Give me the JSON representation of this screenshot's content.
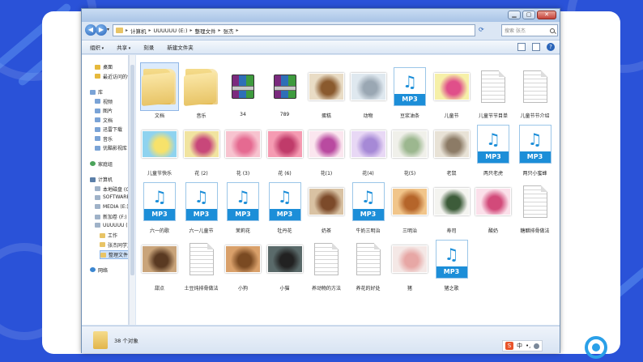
{
  "window": {
    "controls": {
      "minimize": "▁",
      "maximize": "▢",
      "close": "✕"
    }
  },
  "address": {
    "back": "◀",
    "forward": "▶",
    "dropdown": "▾",
    "crumbs": [
      "计算机",
      "UUUUUU (E:)",
      "整理文件",
      "张杰"
    ],
    "separator": "▸",
    "refresh": "⟳",
    "search_placeholder": "搜索 张杰"
  },
  "toolbar": {
    "organize": "组织",
    "share": "共享",
    "burn": "刻录",
    "new_folder": "新建文件夹",
    "help": "?"
  },
  "nav": {
    "favorites": [
      {
        "label": "桌面",
        "icon": "desktop-icon"
      },
      {
        "label": "最近访问的位置",
        "icon": "recent-icon"
      }
    ],
    "libraries_header": "库",
    "libraries": [
      {
        "label": "视频",
        "icon": "video-icon"
      },
      {
        "label": "图片",
        "icon": "picture-icon"
      },
      {
        "label": "文档",
        "icon": "document-icon"
      },
      {
        "label": "迅雷下载",
        "icon": "download-icon"
      },
      {
        "label": "音乐",
        "icon": "music-icon"
      },
      {
        "label": "优酷影视库",
        "icon": "youku-icon"
      }
    ],
    "homegroup": "家庭组",
    "computer_header": "计算机",
    "drives": [
      {
        "label": "本地磁盘 (C:)"
      },
      {
        "label": "SOFTWARE (D:)"
      },
      {
        "label": "MEDIA (E:)"
      },
      {
        "label": "新加卷 (F:)"
      },
      {
        "label": "UUUUUU (E:)"
      }
    ],
    "folders": [
      {
        "label": "工作"
      },
      {
        "label": "张杰同学文件"
      },
      {
        "label": "整理文件",
        "selected": true
      }
    ],
    "network": "网络"
  },
  "files": [
    {
      "name": "文档",
      "type": "folder",
      "selected": true
    },
    {
      "name": "音乐",
      "type": "folder"
    },
    {
      "name": "34",
      "type": "rar"
    },
    {
      "name": "789",
      "type": "rar"
    },
    {
      "name": "蛋糕",
      "type": "image",
      "colors": [
        "#e9dcc5",
        "#8a5a2e"
      ]
    },
    {
      "name": "动物",
      "type": "image",
      "colors": [
        "#dfe8ef",
        "#9aa7b3"
      ]
    },
    {
      "name": "豆浆油条",
      "type": "mp3"
    },
    {
      "name": "儿童节",
      "type": "image",
      "colors": [
        "#f6f0a8",
        "#e04f8a"
      ]
    },
    {
      "name": "儿童节节目单",
      "type": "doc"
    },
    {
      "name": "儿童节节介绍",
      "type": "doc"
    },
    {
      "name": "儿童节快乐",
      "type": "image",
      "colors": [
        "#8fd3ef",
        "#f7e26a"
      ]
    },
    {
      "name": "花 (2)",
      "type": "image",
      "colors": [
        "#f1e4a0",
        "#c8477a"
      ]
    },
    {
      "name": "花 (3)",
      "type": "image",
      "colors": [
        "#f7c3cf",
        "#e56a91"
      ]
    },
    {
      "name": "花 (6)",
      "type": "image",
      "colors": [
        "#f59bb2",
        "#c03b6a"
      ]
    },
    {
      "name": "花(1)",
      "type": "image",
      "colors": [
        "#fbe6ef",
        "#b94aa0"
      ]
    },
    {
      "name": "花(4)",
      "type": "image",
      "colors": [
        "#e8d8f5",
        "#a689d6"
      ]
    },
    {
      "name": "花(5)",
      "type": "image",
      "colors": [
        "#f0f0ea",
        "#9cb78f"
      ]
    },
    {
      "name": "老鼠",
      "type": "image",
      "colors": [
        "#e8e2d6",
        "#8c7b66"
      ]
    },
    {
      "name": "两只老虎",
      "type": "mp3"
    },
    {
      "name": "两只小蜜蜂",
      "type": "mp3"
    },
    {
      "name": "六一的歌",
      "type": "mp3"
    },
    {
      "name": "六一儿童节",
      "type": "mp3"
    },
    {
      "name": "茉莉花",
      "type": "mp3"
    },
    {
      "name": "牡丹花",
      "type": "mp3"
    },
    {
      "name": "奶茶",
      "type": "image",
      "colors": [
        "#d9c2a3",
        "#7c4a2a"
      ]
    },
    {
      "name": "牛奶三明治",
      "type": "mp3"
    },
    {
      "name": "三明治",
      "type": "image",
      "colors": [
        "#f1c58a",
        "#b5652a"
      ]
    },
    {
      "name": "寿司",
      "type": "image",
      "colors": [
        "#f4f4f0",
        "#3d5c3a"
      ]
    },
    {
      "name": "酸奶",
      "type": "image",
      "colors": [
        "#fbe0ea",
        "#d24a7a"
      ]
    },
    {
      "name": "糖醋排骨做法",
      "type": "doc"
    },
    {
      "name": "甜点",
      "type": "image",
      "colors": [
        "#c9a47a",
        "#5a3a22"
      ]
    },
    {
      "name": "土豆炖排骨做法",
      "type": "doc"
    },
    {
      "name": "小狗",
      "type": "image",
      "colors": [
        "#d9a06a",
        "#7a4a22"
      ]
    },
    {
      "name": "小猫",
      "type": "image",
      "colors": [
        "#5a6a6a",
        "#222"
      ]
    },
    {
      "name": "养动物的方法",
      "type": "doc"
    },
    {
      "name": "养花的好处",
      "type": "doc"
    },
    {
      "name": "猪",
      "type": "image",
      "colors": [
        "#f4e8e6",
        "#e7a7a5"
      ]
    },
    {
      "name": "猪之歌",
      "type": "mp3"
    }
  ],
  "mp3_label": "MP3",
  "mp3_note": "♫",
  "status": {
    "count_text": "38 个对象"
  },
  "ime": {
    "logo": "S",
    "lang": "中",
    "punct": "•,"
  }
}
